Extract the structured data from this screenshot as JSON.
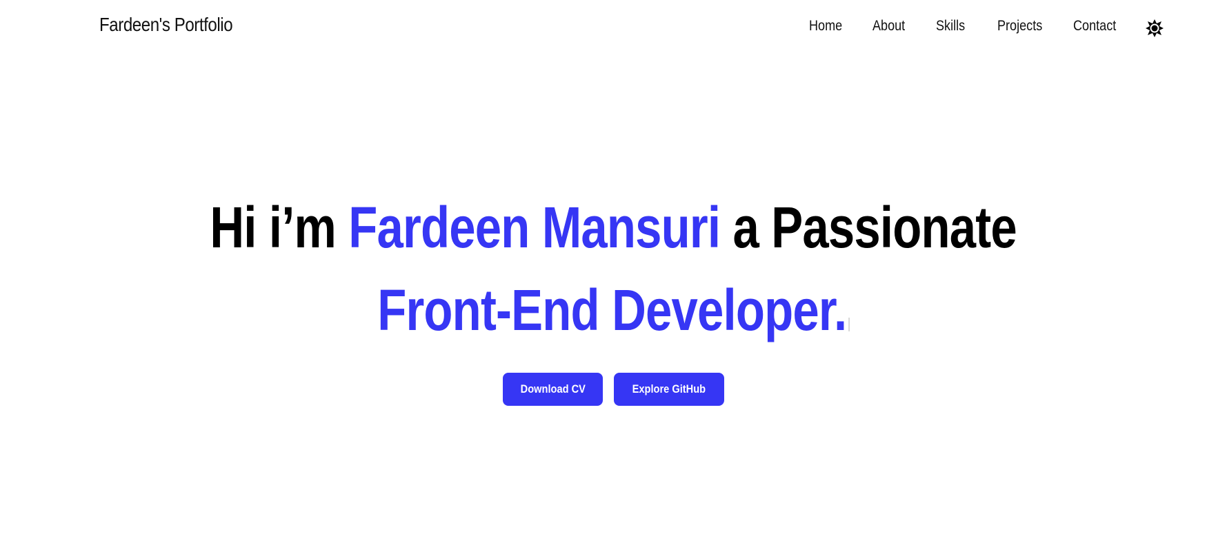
{
  "header": {
    "brand": "Fardeen's Portfolio",
    "nav": [
      {
        "label": "Home"
      },
      {
        "label": "About"
      },
      {
        "label": "Skills"
      },
      {
        "label": "Projects"
      },
      {
        "label": "Contact"
      }
    ],
    "theme_toggle_icon": "sun-icon"
  },
  "hero": {
    "line1": {
      "prefix": "Hi i’m",
      "name": "Fardeen Mansuri",
      "suffix": "a Passionate"
    },
    "line2": {
      "role": "Front-End Developer."
    },
    "buttons": {
      "download_cv": "Download CV",
      "explore_github": "Explore GitHub"
    }
  },
  "colors": {
    "accent": "#3636f4",
    "text": "#000000",
    "background": "#ffffff"
  }
}
